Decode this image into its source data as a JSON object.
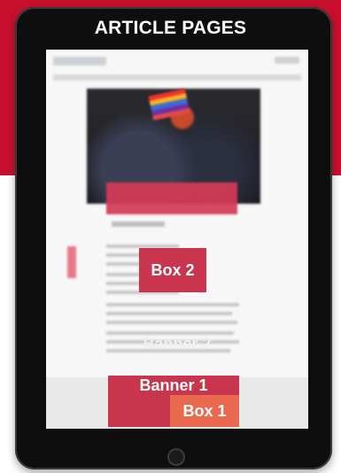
{
  "header": {
    "title": "ARTICLE PAGES"
  },
  "placements": {
    "box2": "Box 2",
    "banner2": "Banner 2",
    "banner1": "Banner 1",
    "box1": "Box 1"
  },
  "colors": {
    "brand_red": "#c8102e",
    "ad_red": "#c8354d",
    "ad_orange": "#ea6a4f"
  },
  "icons": {
    "home_button": "home-button-icon"
  }
}
